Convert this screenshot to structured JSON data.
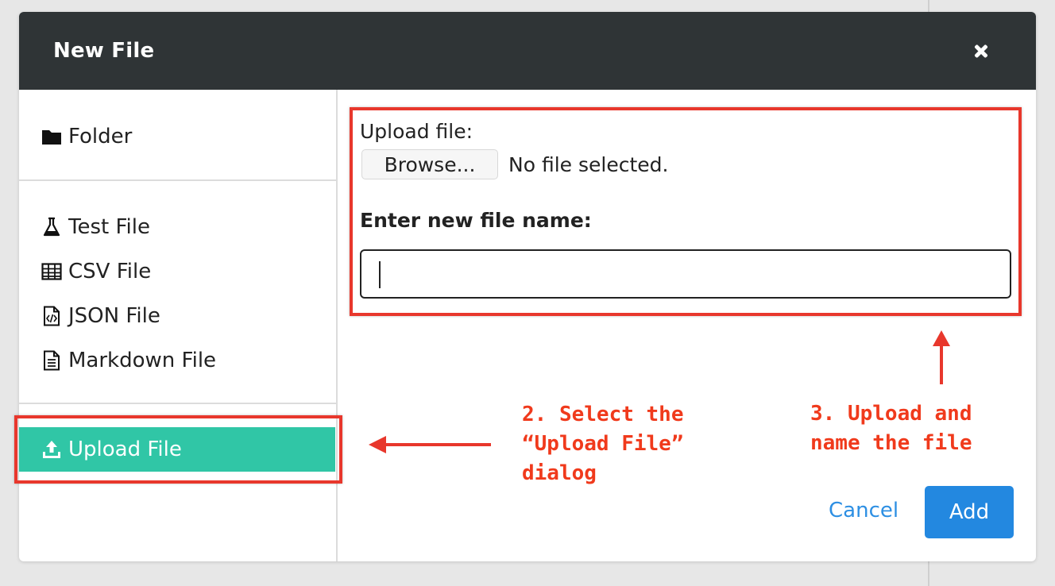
{
  "dialog": {
    "title": "New File",
    "close_icon": "close-icon"
  },
  "sidebar": {
    "items": [
      {
        "label": "Folder",
        "icon": "folder-icon"
      },
      {
        "label": "Test File",
        "icon": "flask-icon"
      },
      {
        "label": "CSV File",
        "icon": "table-icon"
      },
      {
        "label": "JSON File",
        "icon": "code-file-icon"
      },
      {
        "label": "Markdown File",
        "icon": "document-icon"
      }
    ],
    "upload": {
      "label": "Upload File",
      "icon": "upload-icon",
      "selected": true,
      "color": "#30c6a6"
    }
  },
  "form": {
    "upload_label": "Upload file:",
    "browse_label": "Browse...",
    "no_file_text": "No file selected.",
    "name_label": "Enter new file name:",
    "name_value": ""
  },
  "actions": {
    "cancel_label": "Cancel",
    "add_label": "Add",
    "add_color": "#2388e0"
  },
  "annotations": {
    "step2": "2. Select the\n“Upload File”\ndialog",
    "step3": "3. Upload and\nname the file",
    "color": "#e8372c"
  }
}
